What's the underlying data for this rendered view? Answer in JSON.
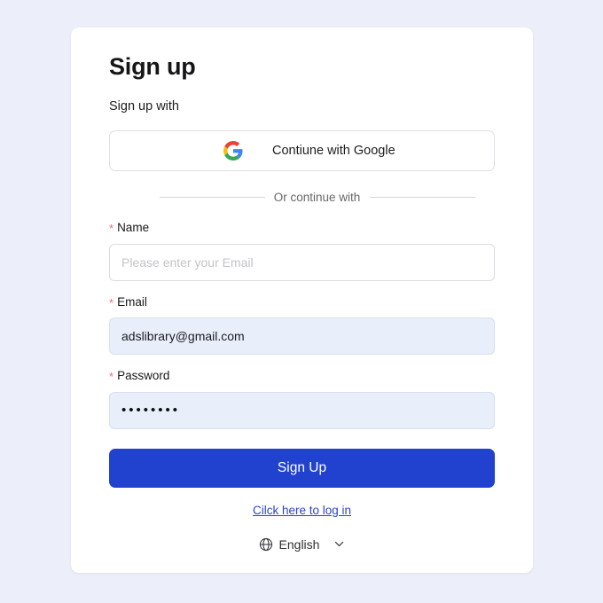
{
  "card": {
    "title": "Sign up",
    "subtitle": "Sign up with",
    "oauth": {
      "label": "Contiune with Google",
      "icon": "google-icon"
    },
    "divider": {
      "text": "Or continue with"
    },
    "fields": [
      {
        "key": "name",
        "label": "Name",
        "required_mark": "*",
        "value": "",
        "placeholder": "Please enter your Email",
        "state": "empty"
      },
      {
        "key": "email",
        "label": "Email",
        "required_mark": "*",
        "value": "adslibrary@gmail.com",
        "placeholder": "",
        "state": "autofilled"
      },
      {
        "key": "password",
        "label": "Password",
        "required_mark": "*",
        "value": "••••••••",
        "placeholder": "",
        "state": "autofilled",
        "masked_char_count": 8
      }
    ],
    "submit": {
      "label": "Sign Up"
    },
    "login_link": {
      "label": "Cilck here to log in"
    },
    "language": {
      "label": "English",
      "globe_icon": "globe-icon",
      "chevron_icon": "chevron-down-icon"
    }
  },
  "colors": {
    "page_background": "#eceef9",
    "card_background": "#ffffff",
    "primary_button": "#2042ce",
    "link": "#2a45cc",
    "required_asterisk": "#f56c6c",
    "autofill_background": "#e8eefa",
    "input_border": "#dcdcdf",
    "google_red": "#ea4335",
    "google_yellow": "#fbbc05",
    "google_green": "#34a853",
    "google_blue": "#4285f4"
  }
}
